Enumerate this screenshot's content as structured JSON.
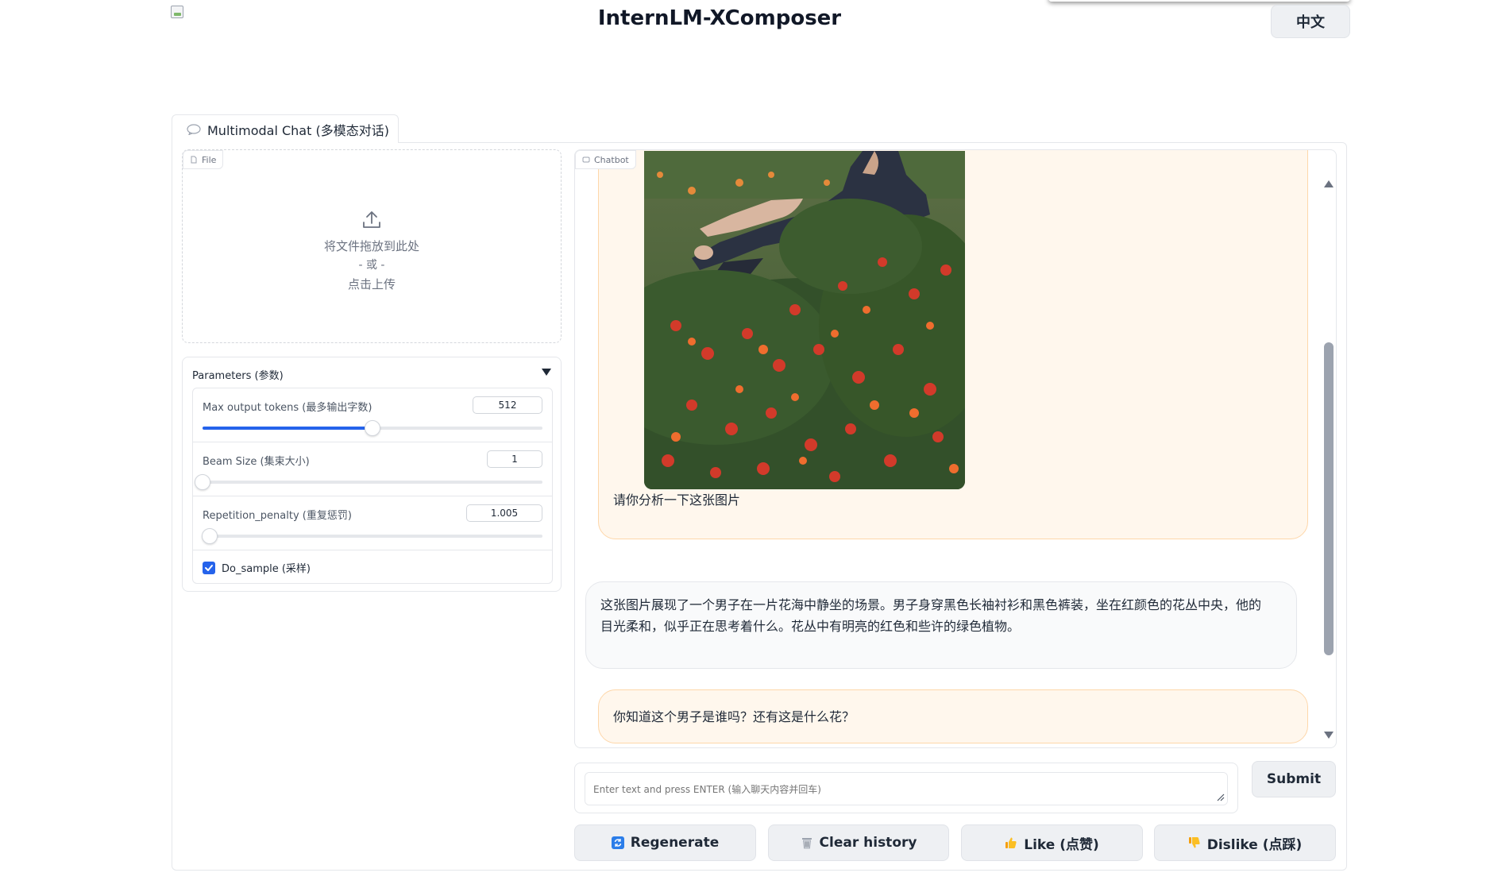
{
  "header": {
    "title": "InternLM-XComposer",
    "lang_button": "中文"
  },
  "tabs": [
    {
      "label": "Multimodal Chat (多模态对话)",
      "icon": "chat-bubble-icon"
    }
  ],
  "file_upload": {
    "label": "File",
    "drop_text": "将文件拖放到此处",
    "or_text": "- 或 -",
    "click_text": "点击上传"
  },
  "parameters": {
    "title": "Parameters (参数)",
    "max_tokens": {
      "label": "Max output tokens (最多输出字数)",
      "value": "512",
      "fraction": 0.5
    },
    "beam_size": {
      "label": "Beam Size (集束大小)",
      "value": "1",
      "fraction": 0.0
    },
    "repetition_penalty": {
      "label": "Repetition_penalty (重复惩罚)",
      "value": "1.005",
      "fraction": 0.02
    },
    "do_sample": {
      "label": "Do_sample (采样)",
      "checked": true
    }
  },
  "chatbot": {
    "label": "Chatbot",
    "messages": [
      {
        "role": "user",
        "text": "请你分析一下这张图片",
        "image": "man-sitting-among-flowers"
      },
      {
        "role": "bot",
        "line1": "这张图片展现了一个男子在一片花海中静坐的场景。男子身穿黑色长袖衬衫和黑色裤装，坐在红颜色的花丛中央，他的",
        "line2": "目光柔和，似乎正在思考着什么。花丛中有明亮的红色和些许的绿色植物。"
      },
      {
        "role": "user",
        "text": "你知道这个男子是谁吗？还有这是什么花？"
      }
    ]
  },
  "input": {
    "placeholder": "Enter text and press ENTER (输入聊天内容并回车)",
    "submit": "Submit"
  },
  "actions": {
    "regenerate": "Regenerate",
    "clear": "Clear history",
    "like": "Like (点赞)",
    "dislike": "Dislike (点踩)"
  },
  "colors": {
    "accent": "#2563eb",
    "user_bubble": "#fff7ed",
    "bot_bubble": "#f9fafb"
  }
}
